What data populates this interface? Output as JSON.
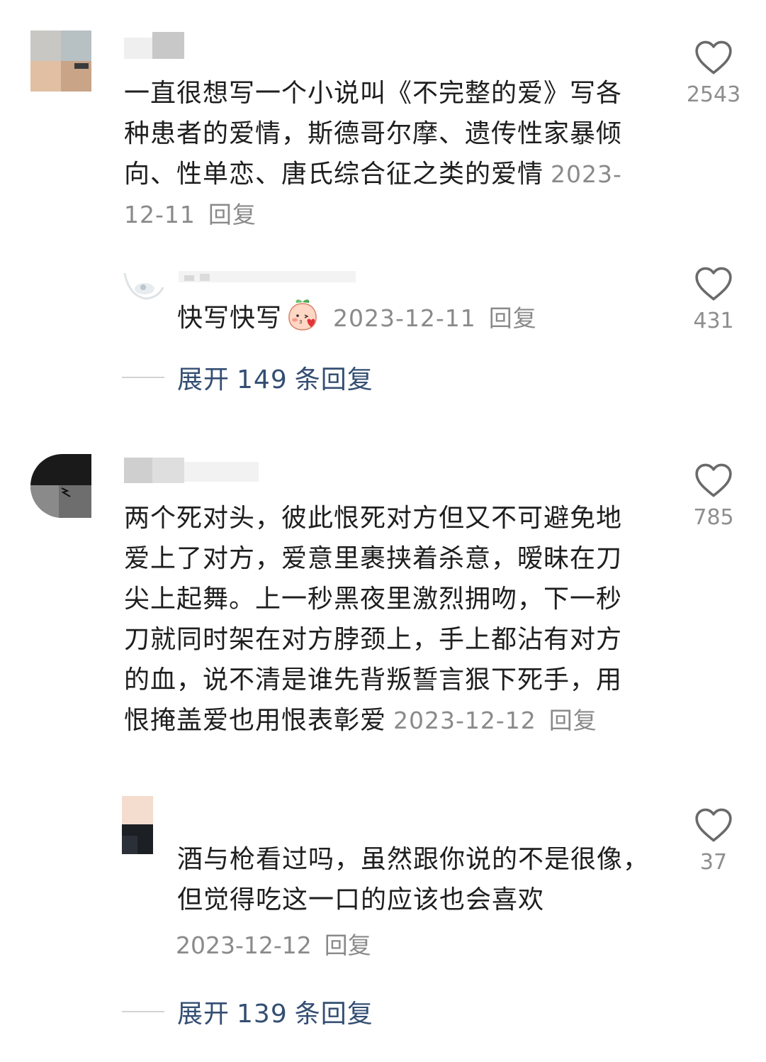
{
  "colors": {
    "text": "#1e1e1e",
    "meta": "#8a8a8a",
    "link": "#344e73",
    "like_icon": "#6a6a6a"
  },
  "threads": [
    {
      "comment": {
        "text": "一直很想写一个小说叫《不完整的爱》写各种患者的爱情，斯德哥尔摩、遗传性家暴倾向、性单恋、唐氏综合征之类的爱情",
        "date": "2023-12-11",
        "reply_label": "回复",
        "likes": "2543"
      },
      "reply": {
        "text": "快写快写",
        "emoji": "blushing-peach-emoji",
        "date": "2023-12-11",
        "reply_label": "回复",
        "likes": "431"
      },
      "expand": {
        "prefix": "展开",
        "count": "149",
        "suffix": "条回复"
      }
    },
    {
      "comment": {
        "text": "两个死对头，彼此恨死对方但又不可避免地爱上了对方，爱意里裹挟着杀意，暧昧在刀尖上起舞。上一秒黑夜里激烈拥吻，下一秒刀就同时架在对方脖颈上，手上都沾有对方的血，说不清是谁先背叛誓言狠下死手，用恨掩盖爱也用恨表彰爱",
        "date": "2023-12-12",
        "reply_label": "回复",
        "likes": "785"
      },
      "reply": {
        "text": "酒与枪看过吗，虽然跟你说的不是很像，但觉得吃这一口的应该也会喜欢",
        "date": "2023-12-12",
        "reply_label": "回复",
        "likes": "37"
      },
      "expand": {
        "prefix": "展开",
        "count": "139",
        "suffix": "条回复"
      }
    }
  ]
}
